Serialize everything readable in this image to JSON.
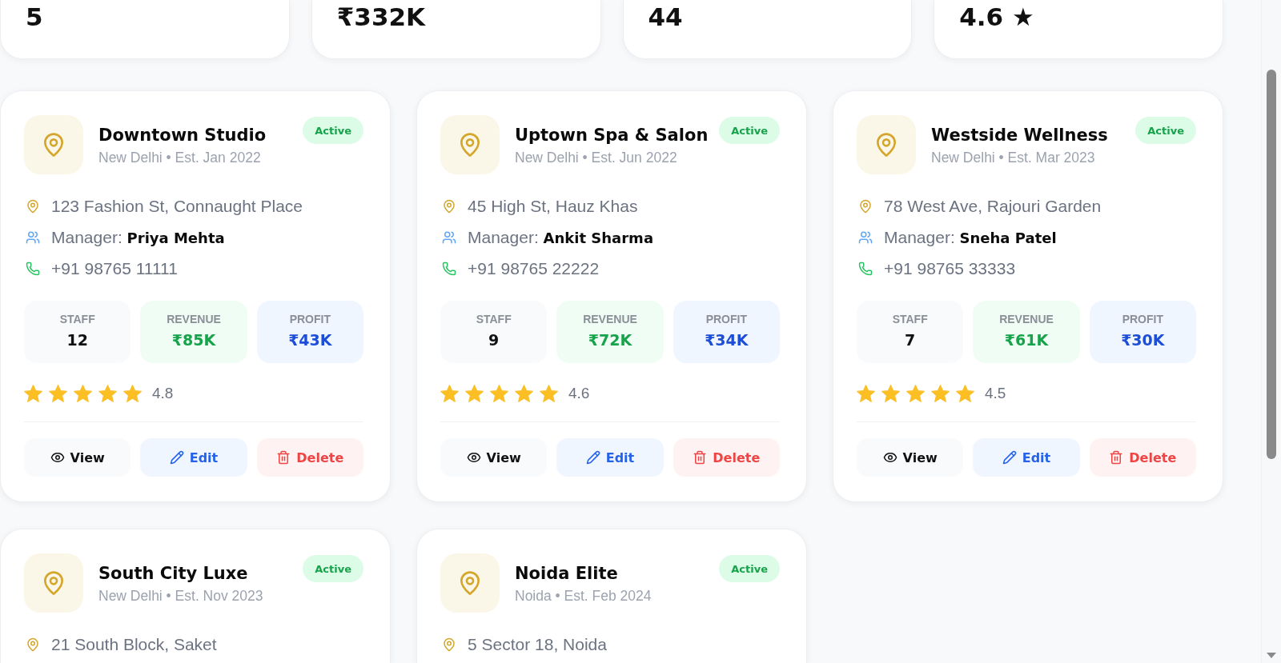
{
  "stats": [
    {
      "value": "5"
    },
    {
      "value": "₹332K"
    },
    {
      "value": "44"
    },
    {
      "value": "4.6 ★"
    }
  ],
  "branches": [
    {
      "name": "Downtown Studio",
      "subtitle": "New Delhi • Est. Jan 2022",
      "status": "Active",
      "address": "123 Fashion St, Connaught Place",
      "manager": "Manager: **Priya Mehta**",
      "phone": "+91 98765 11111",
      "metrics": [
        {
          "kind": "staff",
          "label": "STAFF",
          "value": "12"
        },
        {
          "kind": "revenue",
          "label": "REVENUE",
          "value": "₹85K"
        },
        {
          "kind": "profit",
          "label": "PROFIT",
          "value": "₹43K"
        }
      ],
      "stars": 5,
      "rating": "4.8",
      "actions": [
        {
          "kind": "view",
          "label": "View"
        },
        {
          "kind": "edit",
          "label": "Edit"
        },
        {
          "kind": "delete",
          "label": "Delete"
        }
      ]
    },
    {
      "name": "Uptown Spa & Salon",
      "subtitle": "New Delhi • Est. Jun 2022",
      "status": "Active",
      "address": "45 High St, Hauz Khas",
      "manager": "Manager: **Ankit Sharma**",
      "phone": "+91 98765 22222",
      "metrics": [
        {
          "kind": "staff",
          "label": "STAFF",
          "value": "9"
        },
        {
          "kind": "revenue",
          "label": "REVENUE",
          "value": "₹72K"
        },
        {
          "kind": "profit",
          "label": "PROFIT",
          "value": "₹34K"
        }
      ],
      "stars": 5,
      "rating": "4.6",
      "actions": [
        {
          "kind": "view",
          "label": "View"
        },
        {
          "kind": "edit",
          "label": "Edit"
        },
        {
          "kind": "delete",
          "label": "Delete"
        }
      ]
    },
    {
      "name": "Westside Wellness",
      "subtitle": "New Delhi • Est. Mar 2023",
      "status": "Active",
      "address": "78 West Ave, Rajouri Garden",
      "manager": "Manager: **Sneha Patel**",
      "phone": "+91 98765 33333",
      "metrics": [
        {
          "kind": "staff",
          "label": "STAFF",
          "value": "7"
        },
        {
          "kind": "revenue",
          "label": "REVENUE",
          "value": "₹61K"
        },
        {
          "kind": "profit",
          "label": "PROFIT",
          "value": "₹30K"
        }
      ],
      "stars": 5,
      "rating": "4.5",
      "actions": [
        {
          "kind": "view",
          "label": "View"
        },
        {
          "kind": "edit",
          "label": "Edit"
        },
        {
          "kind": "delete",
          "label": "Delete"
        }
      ]
    },
    {
      "name": "South City Luxe",
      "subtitle": "New Delhi • Est. Nov 2023",
      "status": "Active",
      "address": "21 South Block, Saket"
    },
    {
      "name": "Noida Elite",
      "subtitle": "Noida • Est. Feb 2024",
      "status": "Active",
      "address": "5 Sector 18, Noida"
    }
  ]
}
